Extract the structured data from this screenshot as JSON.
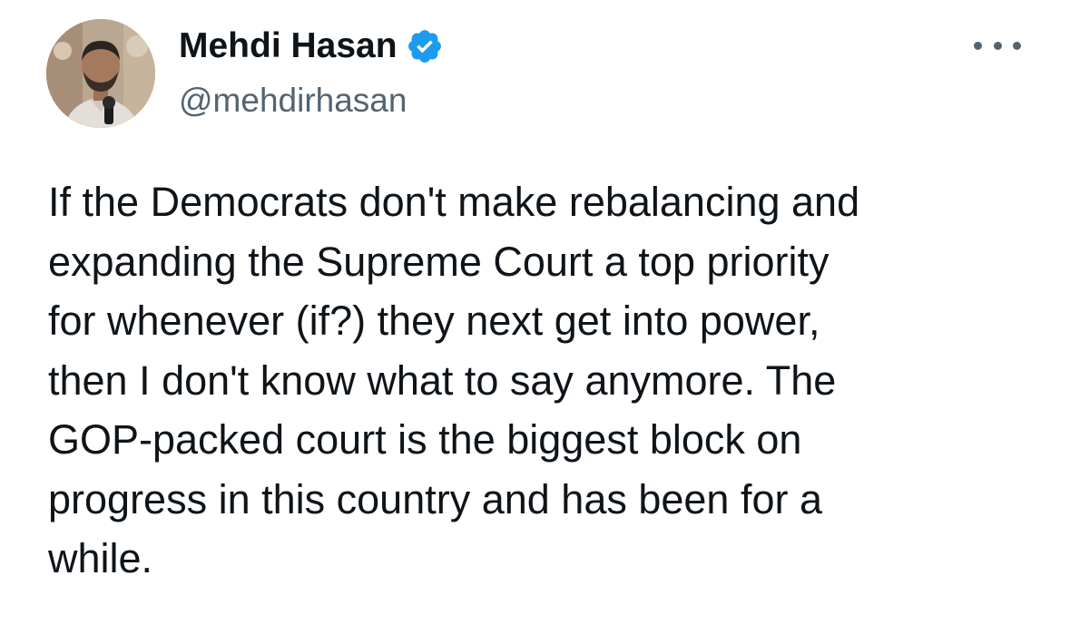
{
  "author": {
    "display_name": "Mehdi Hasan",
    "handle": "@mehdirhasan",
    "verified": true,
    "verified_color": "#1d9bf0"
  },
  "tweet": {
    "text": "If the Democrats don't make rebalancing and\nexpanding the Supreme Court a top priority\nfor whenever (if?) they next get into power,\nthen I don't know what to say anymore. The\nGOP-packed court is the biggest block on\nprogress in this country and has been for a\nwhile."
  },
  "icons": {
    "avatar": "profile-photo",
    "verified": "verified-badge-icon",
    "more": "more-options-icon"
  }
}
